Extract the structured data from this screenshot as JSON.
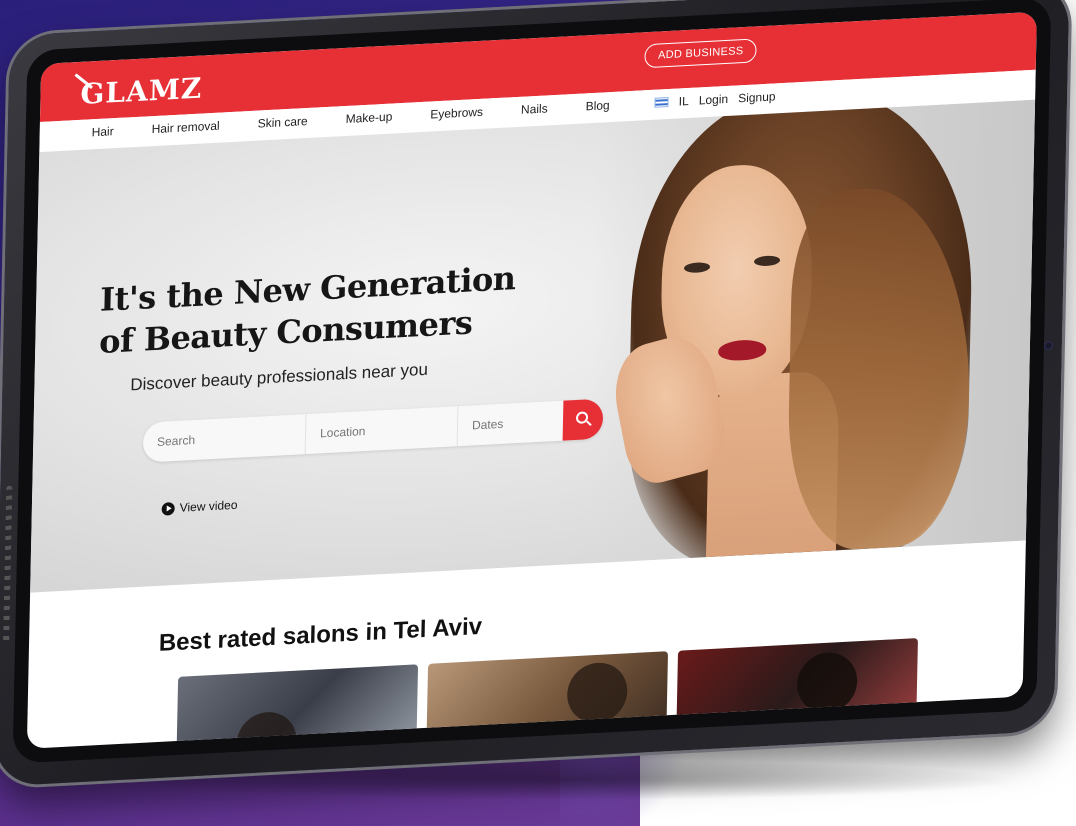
{
  "brand": {
    "logo_text": "GLAMZ",
    "accent_color": "#e63036"
  },
  "header": {
    "add_business_label": "ADD BUSINESS"
  },
  "nav": {
    "items": [
      {
        "label": "Hair"
      },
      {
        "label": "Hair removal"
      },
      {
        "label": "Skin care"
      },
      {
        "label": "Make-up"
      },
      {
        "label": "Eyebrows"
      },
      {
        "label": "Nails"
      },
      {
        "label": "Blog"
      }
    ],
    "region_label": "IL",
    "login_label": "Login",
    "signup_label": "Signup",
    "flag_icon": "israel-flag-icon"
  },
  "hero": {
    "title_line1": "It's the New Generation",
    "title_line2": "of Beauty Consumers",
    "subtitle": "Discover beauty professionals near you",
    "search": {
      "search_placeholder": "Search",
      "location_placeholder": "Location",
      "dates_placeholder": "Dates",
      "button_icon": "search-icon"
    },
    "view_video_label": "View video",
    "view_video_icon": "play-icon"
  },
  "salons": {
    "section_title": "Best rated salons in Tel Aviv"
  }
}
